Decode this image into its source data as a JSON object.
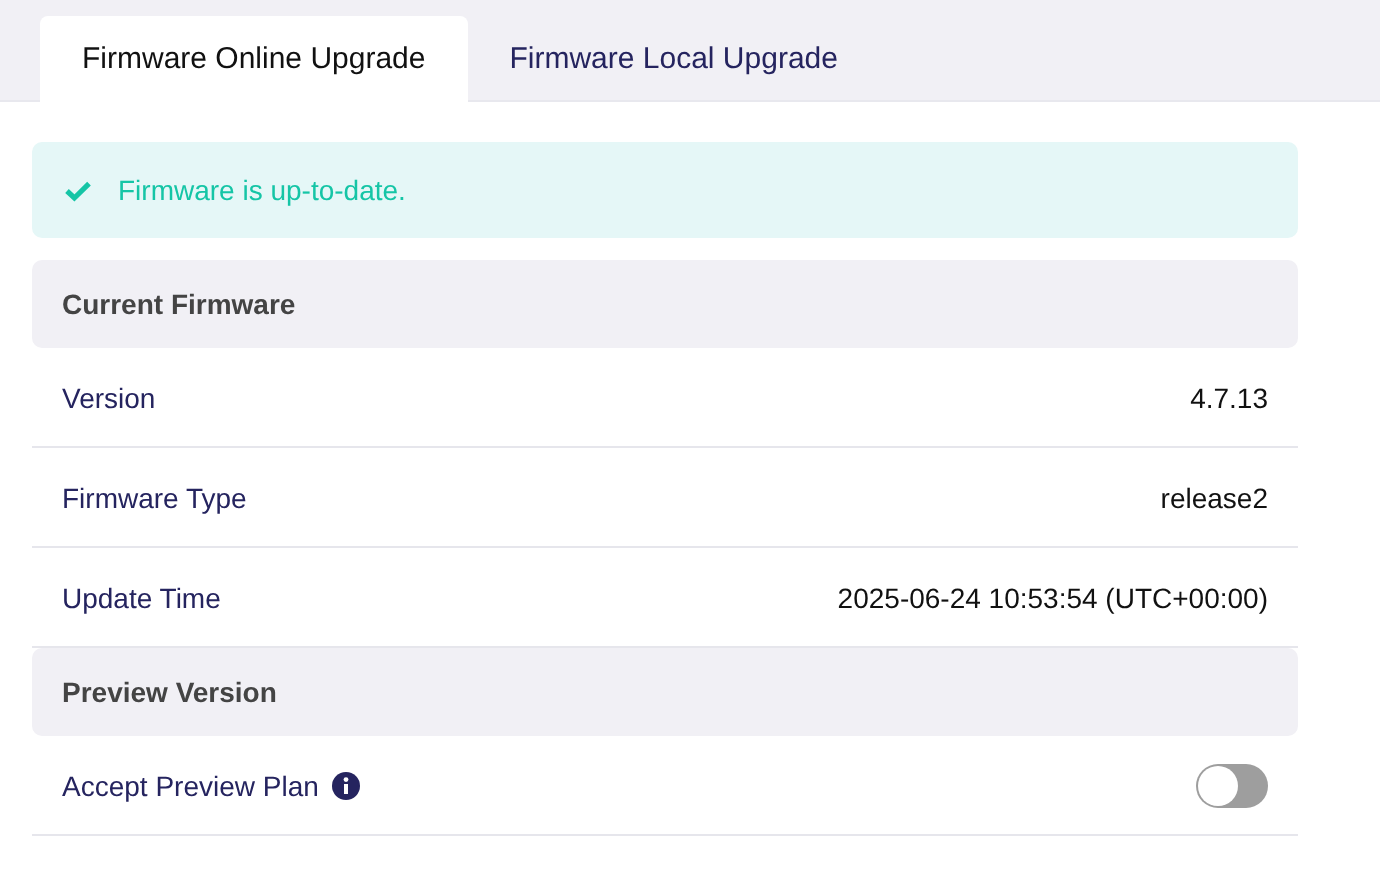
{
  "tabs": [
    {
      "label": "Firmware Online Upgrade",
      "selected": true
    },
    {
      "label": "Firmware Local Upgrade",
      "selected": false
    }
  ],
  "alert": {
    "text": "Firmware is up-to-date."
  },
  "sections": [
    {
      "title": "Current Firmware",
      "rows": [
        {
          "kind": "text",
          "label": "Version",
          "value": "4.7.13"
        },
        {
          "kind": "text",
          "label": "Firmware Type",
          "value": "release2"
        },
        {
          "kind": "text",
          "label": "Update Time",
          "value": "2025-06-24 10:53:54 (UTC+00:00)"
        }
      ]
    },
    {
      "title": "Preview Version",
      "rows": [
        {
          "kind": "toggle",
          "label": "Accept Preview Plan",
          "info": true,
          "on": false
        }
      ]
    }
  ]
}
